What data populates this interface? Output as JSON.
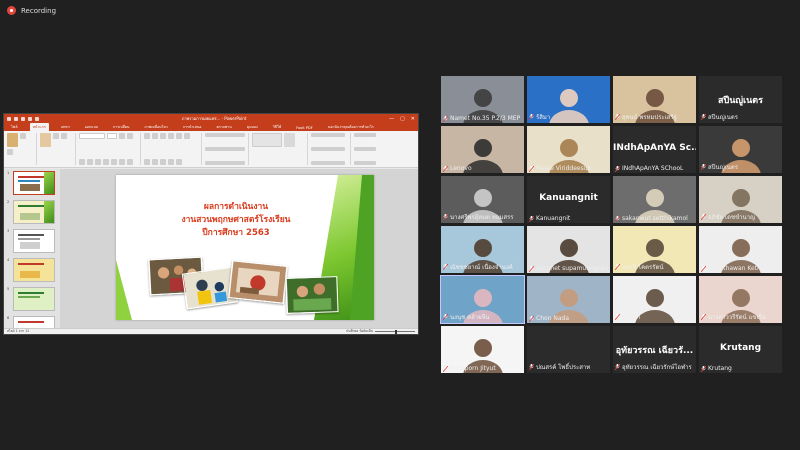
{
  "recording": {
    "label": "Recording"
  },
  "ppt": {
    "filename": "ภาพรวมการเผยแพร่... - PowerPoint",
    "tabs": [
      "ไฟล์",
      "หน้าแรก",
      "แทรก",
      "ออกแบบ",
      "การเปลี่ยน",
      "ภาพเคลื่อนไหว",
      "การนำเสนอ",
      "ตรวจทาน",
      "มุมมอง",
      "วิธีใช้",
      "Foxit PDF",
      "บอกฉันว่าคุณต้องการทำอะไร"
    ],
    "slide": {
      "line1": "ผลการดำเนินงาน",
      "line2": "งานสวนพฤกษศาสตร์โรงเรียน",
      "line3": "ปีการศึกษา 2563"
    },
    "status": {
      "left": "สไลด์ 1 จาก 12",
      "right": "บันทึกย่อ   ข้อคิดเห็น"
    }
  },
  "participants": [
    {
      "name": "Namet No.35 P.2/3 MEP",
      "big": ""
    },
    {
      "name": "ร้สิมา",
      "big": ""
    },
    {
      "name": "สุคนธ์ พรหมประเสริฐ",
      "big": ""
    },
    {
      "name": "สปีนญู่เนตร",
      "big": "สปีนญู่เนตร"
    },
    {
      "name": "Lenovo",
      "big": ""
    },
    {
      "name": "Malee Viriddeesuk",
      "big": ""
    },
    {
      "name": "INdhApAnYA SChooL",
      "big": "INdhApAnYA Sc..."
    },
    {
      "name": "สปีนญู่เนตร",
      "big": ""
    },
    {
      "name": "นางศรีพรผุ้หมด หอมสรร",
      "big": ""
    },
    {
      "name": "Kanuangnit",
      "big": "Kanuangnit"
    },
    {
      "name": "sakanwut setthikamol",
      "big": ""
    },
    {
      "name": "อภิชัย เดชขำนาญ",
      "big": ""
    },
    {
      "name": "ณัชชชยาณ์ เนื่องจำนงค์",
      "big": ""
    },
    {
      "name": "sanphet supamuangsan",
      "big": ""
    },
    {
      "name": "แสงจิ โคตรรัตน์",
      "big": ""
    },
    {
      "name": "Khonthawan Ketngam",
      "big": ""
    },
    {
      "name": "นงนุช คล้ายจีน",
      "big": ""
    },
    {
      "name": "Chon Nada",
      "big": ""
    },
    {
      "name": "ปกฤษา",
      "big": ""
    },
    {
      "name": "นางสาววรีรัตน์ แขเริ่ม",
      "big": ""
    },
    {
      "name": "Nuttiporn Jityut",
      "big": ""
    },
    {
      "name": "ปณสรค์ โพธิ์ประสาท",
      "big": ""
    },
    {
      "name": "อุทัยวรรณ เฉียวรักษ์โอฬาร",
      "big": "อุทัยวรรณ เฉียวรั..."
    },
    {
      "name": "Krutang",
      "big": "Krutang"
    }
  ],
  "colors": {
    "accent": "#c43e1c",
    "background": "#202020",
    "slide_title": "#d93b1d"
  }
}
